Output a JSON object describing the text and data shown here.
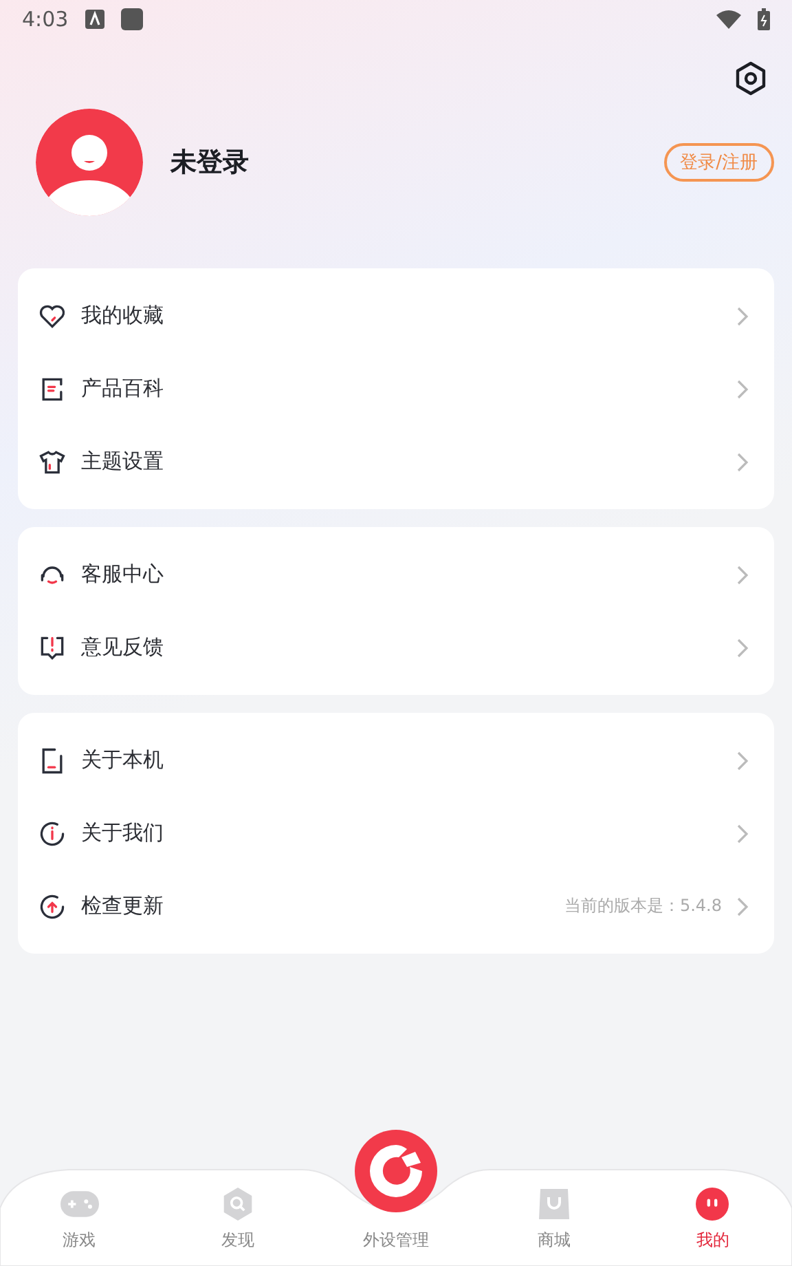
{
  "status_bar": {
    "time": "4:03"
  },
  "profile": {
    "name": "未登录",
    "login_button": "登录/注册"
  },
  "menu_groups": [
    {
      "items": [
        {
          "kind": "heart",
          "label": "我的收藏"
        },
        {
          "kind": "book",
          "label": "产品百科"
        },
        {
          "kind": "shirt",
          "label": "主题设置"
        }
      ]
    },
    {
      "items": [
        {
          "kind": "headset",
          "label": "客服中心"
        },
        {
          "kind": "feedback",
          "label": "意见反馈"
        }
      ]
    },
    {
      "items": [
        {
          "kind": "phone",
          "label": "关于本机"
        },
        {
          "kind": "info",
          "label": "关于我们"
        },
        {
          "kind": "update",
          "label": "检查更新",
          "value": "当前的版本是：5.4.8"
        }
      ]
    }
  ],
  "bottom_nav": [
    {
      "kind": "gamepad",
      "label": "游戏",
      "selected": false
    },
    {
      "kind": "discover",
      "label": "发现",
      "selected": false
    },
    {
      "kind": "center",
      "label": "外设管理",
      "selected": false
    },
    {
      "kind": "shop",
      "label": "商城",
      "selected": false
    },
    {
      "kind": "me",
      "label": "我的",
      "selected": true
    }
  ]
}
